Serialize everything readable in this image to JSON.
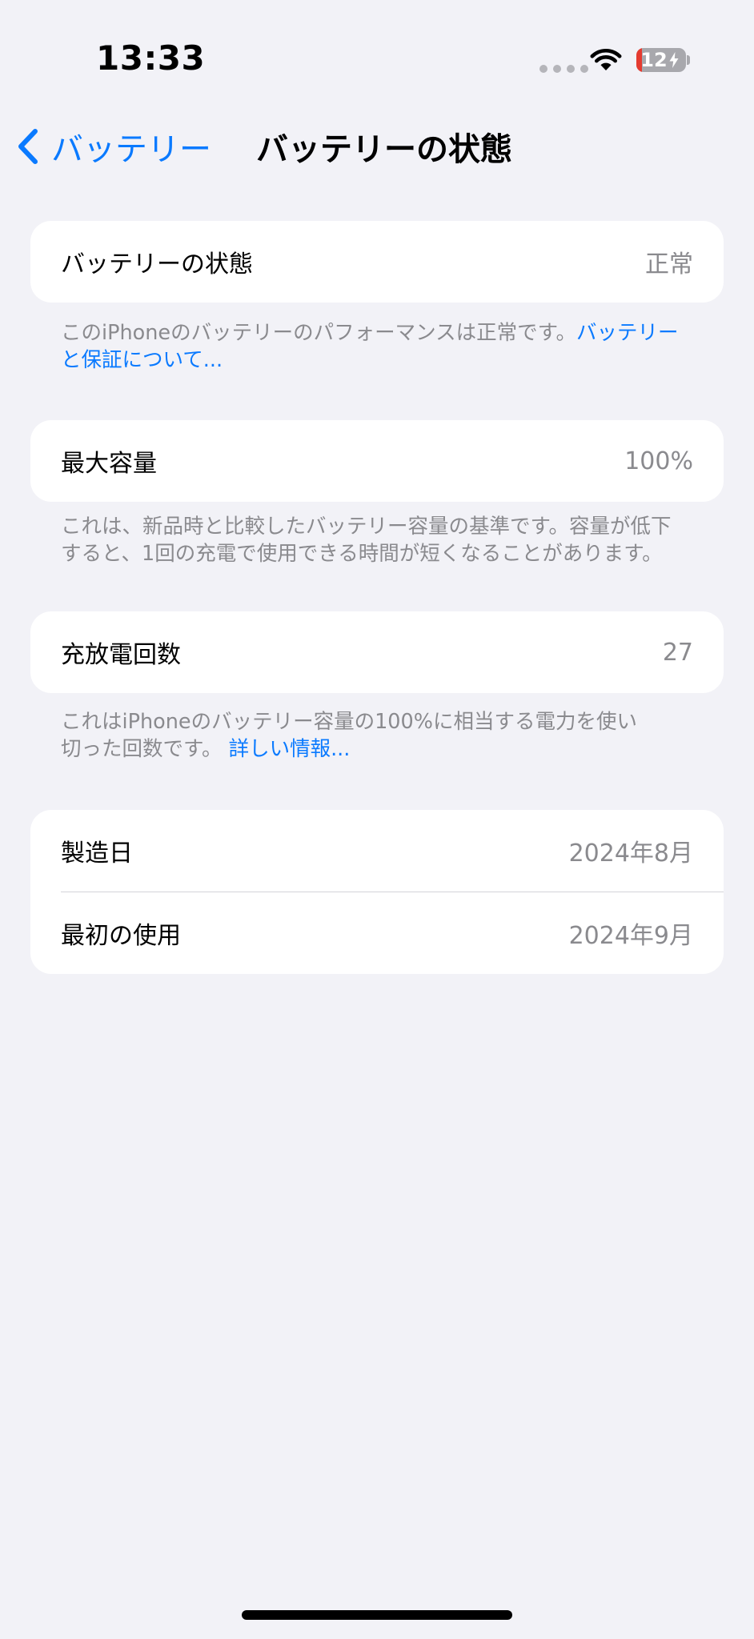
{
  "status_bar": {
    "time": "13:33",
    "battery_level": "12",
    "battery_fraction": 0.12,
    "charging_icon": "bolt-icon",
    "wifi_icon": "wifi-icon"
  },
  "nav": {
    "back_label": "バッテリー",
    "back_icon": "chevron-left-icon",
    "title": "バッテリーの状態"
  },
  "battery_health": {
    "label": "バッテリーの状態",
    "value": "正常",
    "footer_text": "このiPhoneのバッテリーのパフォーマンスは正常です。",
    "footer_link": "バッテリーと保証について..."
  },
  "max_capacity": {
    "label": "最大容量",
    "value": "100%",
    "footer_line1": "これは、新品時と比較したバッテリー容量の基準です。容量が低下",
    "footer_line2": "すると、1回の充電で使用できる時間が短くなることがあります。"
  },
  "cycle_count": {
    "label": "充放電回数",
    "value": "27",
    "footer_line1": "これはiPhoneのバッテリー容量の100%に相当する電力を使い",
    "footer_line2_text": "切った回数です。",
    "footer_link": "詳しい情報..."
  },
  "dates": {
    "manufactured_label": "製造日",
    "manufactured_value": "2024年8月",
    "first_use_label": "最初の使用",
    "first_use_value": "2024年9月"
  },
  "colors": {
    "accent": "#0a7aff",
    "background": "#f2f2f7",
    "secondary_text": "#8a8a8e",
    "battery_low": "#e53b30"
  }
}
